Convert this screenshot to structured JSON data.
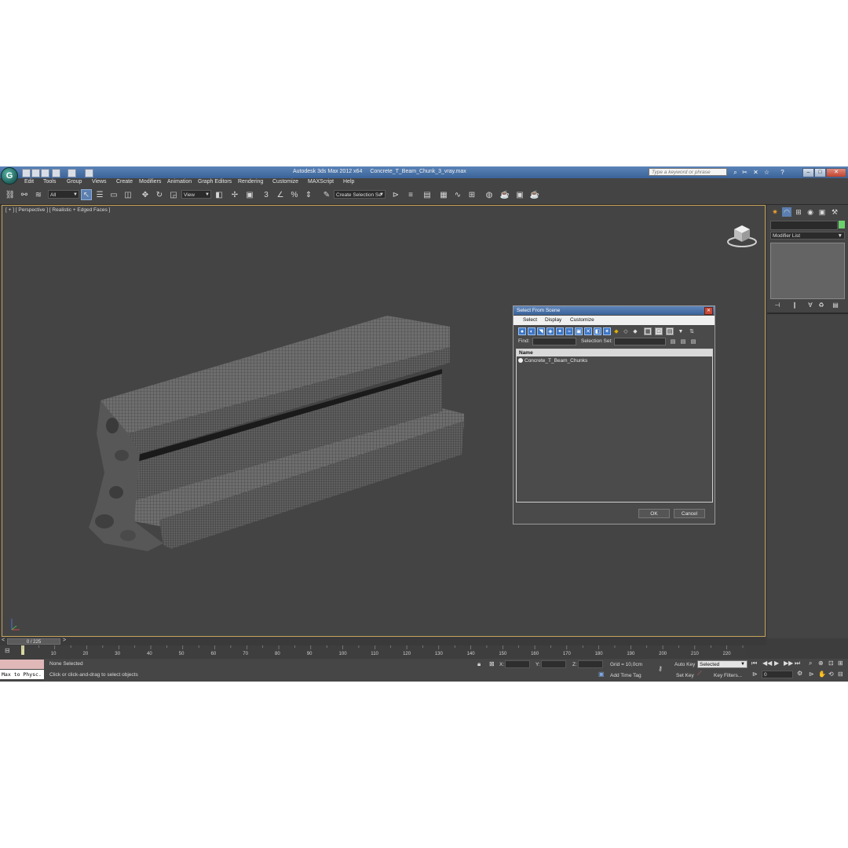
{
  "app": {
    "title": "Autodesk 3ds Max  2012 x64",
    "filename": "Concrete_T_Beam_Chunk_3_vray.max",
    "logo_letter": "G",
    "search_placeholder": "Type a keyword or phrase"
  },
  "menu": [
    "Edit",
    "Tools",
    "Group",
    "Views",
    "Create",
    "Modifiers",
    "Animation",
    "Graph Editors",
    "Rendering",
    "Customize",
    "MAXScript",
    "Help"
  ],
  "toolbar": {
    "filter_value": "All",
    "refcoord_value": "View",
    "selection_set_value": "Create Selection Se",
    "snap_label": "3"
  },
  "viewport": {
    "label": "[ + ] [ Perspective ] [ Realistic + Edged Faces ]",
    "accent_border": "#c7a35a"
  },
  "command_panel": {
    "modifier_list": "Modifier List",
    "object_color": "#6cd06c"
  },
  "dialog": {
    "title": "Select From Scene",
    "menu": [
      "Select",
      "Display",
      "Customize"
    ],
    "find_label": "Find:",
    "selection_set_label": "Selection Set:",
    "column_header": "Name",
    "items": [
      "Concrete_T_Beam_Chunks"
    ],
    "ok_label": "OK",
    "cancel_label": "Cancel"
  },
  "timeline": {
    "frame_display": "0 / 225",
    "current_frame": 0,
    "total_frames": 225,
    "ticks": [
      "10",
      "20",
      "30",
      "40",
      "50",
      "60",
      "70",
      "80",
      "90",
      "100",
      "110",
      "120",
      "130",
      "140",
      "150",
      "160",
      "170",
      "180",
      "190",
      "200",
      "210",
      "220"
    ]
  },
  "status": {
    "maxscript_listener": "Max to Physc.",
    "selection": "None Selected",
    "prompt": "Click or click-and-drag to select objects",
    "x_label": "X:",
    "y_label": "Y:",
    "z_label": "Z:",
    "grid": "Grid = 10,0cm",
    "add_time_tag": "Add Time Tag",
    "auto_key": "Auto Key",
    "set_key": "Set Key",
    "key_mode_value": "Selected",
    "key_filters": "Key Filters...",
    "frame_value": "0"
  }
}
